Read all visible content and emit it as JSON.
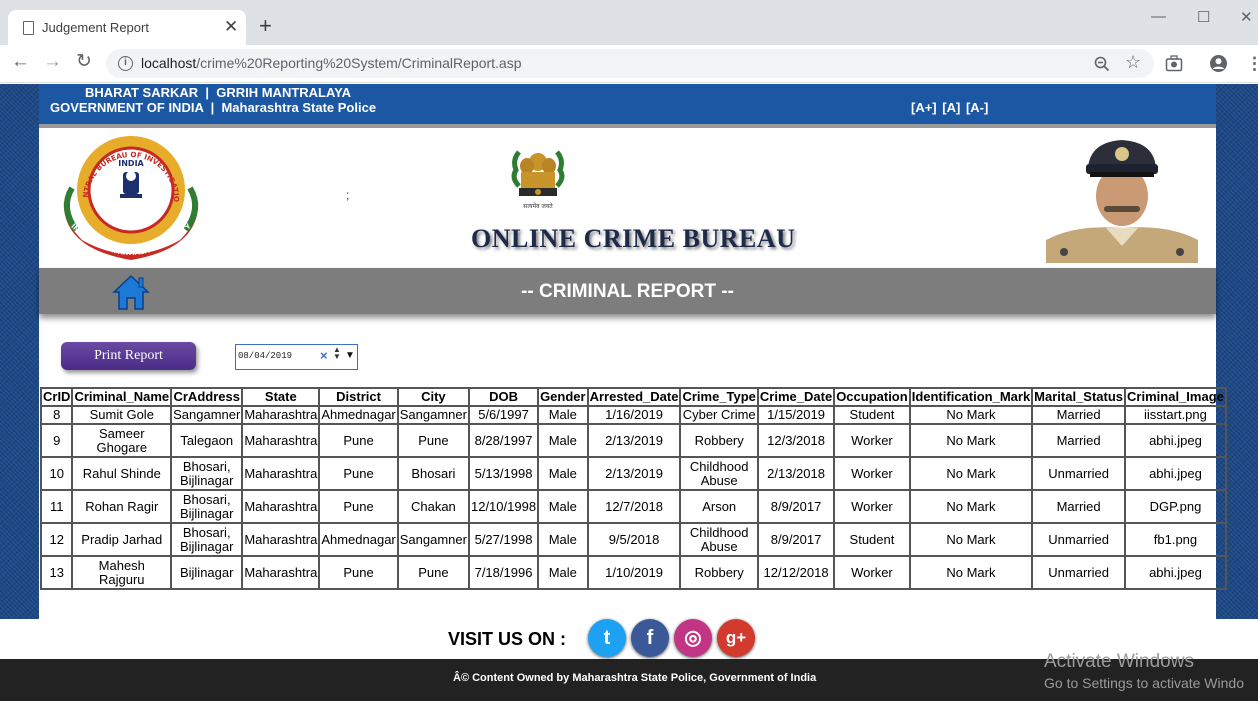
{
  "browser": {
    "tab_title": "Judgement Report",
    "tab_close": "✕",
    "new_tab": "+",
    "url_host": "localhost",
    "url_path": "/crime%20Reporting%20System/CriminalReport.asp",
    "win_minimize": "—",
    "win_maximize": "☐",
    "win_close": "✕"
  },
  "gov_bar": {
    "line1": "BHARAT SARKAR  |  GRRIH MANTRALAYA",
    "line2": "GOVERNMENT OF INDIA  |  Maharashtra State Police",
    "font_plus": "[A+]",
    "font_normal": "[A]",
    "font_minus": "[A-]"
  },
  "header": {
    "semicolon": ";",
    "site_title": "ONLINE CRIME BUREAU",
    "cbi_top": "CENTRAL BUREAU OF INVESTIGATION",
    "cbi_india": "INDIA",
    "cbi_bottom": "INDUSTRY IMPARTIALITY INTEGRITY",
    "emblem_motto": "सत्यमेव जयते"
  },
  "report_bar": {
    "title": "-- CRIMINAL REPORT --"
  },
  "controls": {
    "print_label": "Print Report",
    "date_value": "08/04/2019"
  },
  "table": {
    "columns": [
      "CrID",
      "Criminal_Name",
      "CrAddress",
      "State",
      "District",
      "City",
      "DOB",
      "Gender",
      "Arrested_Date",
      "Crime_Type",
      "Crime_Date",
      "Occupation",
      "Identification_Mark",
      "Marital_Status",
      "Criminal_Image"
    ],
    "rows": [
      [
        "8",
        "Sumit Gole",
        "Sangamner",
        "Maharashtra",
        "Ahmednagar",
        "Sangamner",
        "5/6/1997",
        "Male",
        "1/16/2019",
        "Cyber Crime",
        "1/15/2019",
        "Student",
        "No Mark",
        "Married",
        "iisstart.png"
      ],
      [
        "9",
        "Sameer Ghogare",
        "Talegaon",
        "Maharashtra",
        "Pune",
        "Pune",
        "8/28/1997",
        "Male",
        "2/13/2019",
        "Robbery",
        "12/3/2018",
        "Worker",
        "No Mark",
        "Married",
        "abhi.jpeg"
      ],
      [
        "10",
        "Rahul Shinde",
        "Bhosari, Bijlinagar",
        "Maharashtra",
        "Pune",
        "Bhosari",
        "5/13/1998",
        "Male",
        "2/13/2019",
        "Childhood Abuse",
        "2/13/2018",
        "Worker",
        "No Mark",
        "Unmarried",
        "abhi.jpeg"
      ],
      [
        "11",
        "Rohan Ragir",
        "Bhosari, Bijlinagar",
        "Maharashtra",
        "Pune",
        "Chakan",
        "12/10/1998",
        "Male",
        "12/7/2018",
        "Arson",
        "8/9/2017",
        "Worker",
        "No Mark",
        "Married",
        "DGP.png"
      ],
      [
        "12",
        "Pradip Jarhad",
        "Bhosari, Bijlinagar",
        "Maharashtra",
        "Ahmednagar",
        "Sangamner",
        "5/27/1998",
        "Male",
        "9/5/2018",
        "Childhood Abuse",
        "8/9/2017",
        "Student",
        "No Mark",
        "Unmarried",
        "fb1.png"
      ],
      [
        "13",
        "Mahesh Rajguru",
        "Bijlinagar",
        "Maharashtra",
        "Pune",
        "Pune",
        "7/18/1996",
        "Male",
        "1/10/2019",
        "Robbery",
        "12/12/2018",
        "Worker",
        "No Mark",
        "Unmarried",
        "abhi.jpeg"
      ]
    ]
  },
  "social": {
    "visit_label": "VISIT US ON :",
    "twitter": "t",
    "facebook": "f",
    "instagram": "◎",
    "googleplus": "g+",
    "colors": {
      "twitter": "#1da1f2",
      "facebook": "#3b5998",
      "instagram": "#c13584",
      "googleplus": "#d23a2e"
    }
  },
  "footer": {
    "text": "Â© Content Owned by Maharashtra State Police, Government of India"
  },
  "watermark": {
    "line1": "Activate Windows",
    "line2": "Go to Settings to activate Windo"
  }
}
